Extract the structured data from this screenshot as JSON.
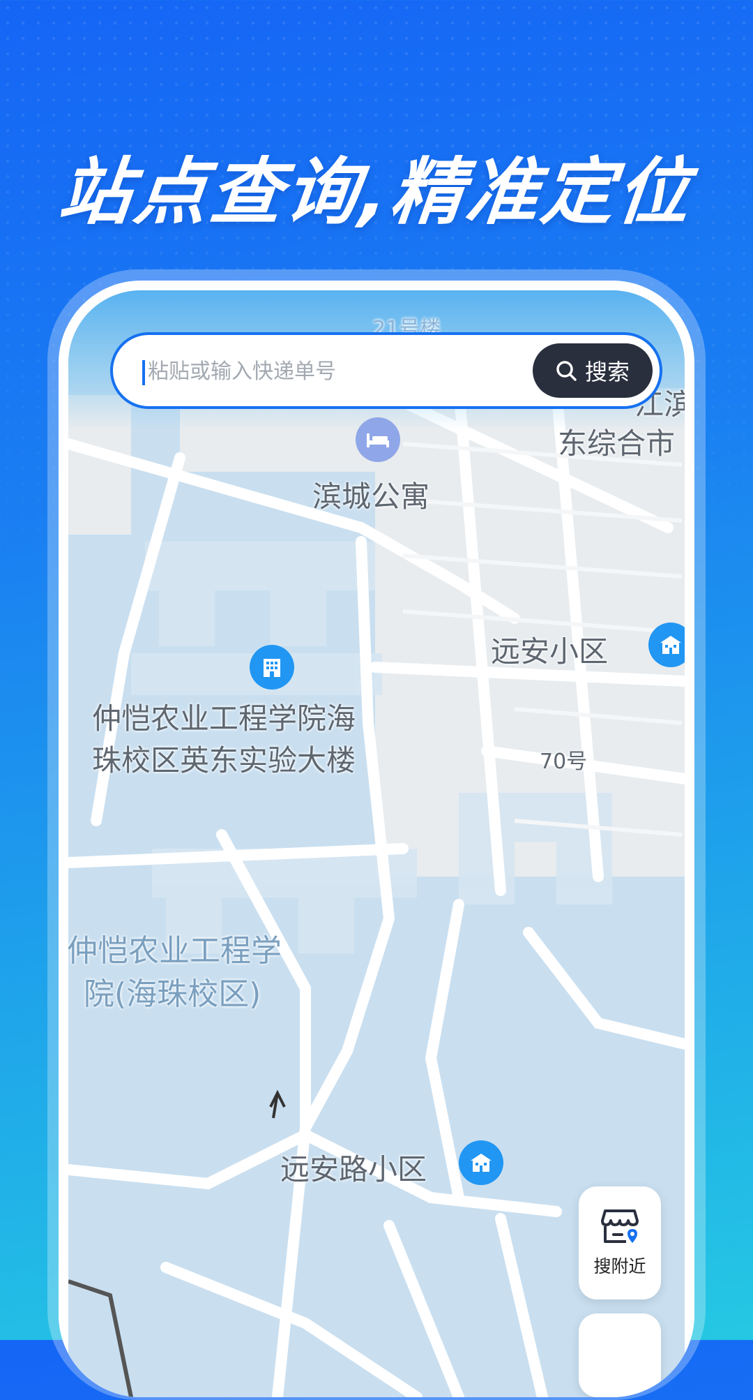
{
  "headline": "站点查询,精准定位",
  "search": {
    "placeholder": "粘贴或输入快递单号",
    "button_label": "搜索"
  },
  "map": {
    "labels": {
      "building_21": "21号楼",
      "binjiang_top": "江滨",
      "dongzonghe": "东综合市",
      "bincheng": "滨城公寓",
      "yuanan": "远安小区",
      "zhongkai_1": "仲恺农业工程学院海",
      "zhongkai_2": "珠校区英东实验大楼",
      "no70": "70号",
      "campus_1": "仲恺农业工程学",
      "campus_2": "院(海珠校区)",
      "yuananlu": "远安路小区"
    }
  },
  "nearby_button": {
    "label": "搜附近"
  },
  "colors": {
    "accent": "#1671f0",
    "search_button": "#2a2f3e",
    "poi_blue": "#2196f3"
  }
}
